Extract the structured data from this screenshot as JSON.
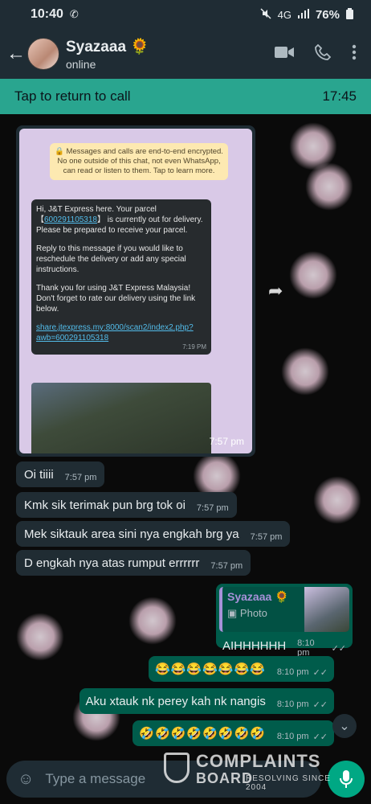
{
  "status_bar": {
    "time": "10:40",
    "network": "4G",
    "battery": "76%"
  },
  "header": {
    "contact_name": "Syazaaa 🌻",
    "contact_status": "online"
  },
  "call_banner": {
    "text": "Tap to return to call",
    "duration": "17:45"
  },
  "forwarded": {
    "encryption_note": "🔒 Messages and calls are end-to-end encrypted. No one outside of this chat, not even WhatsApp, can read or listen to them. Tap to learn more.",
    "jt_intro_prefix": "Hi, J&T Express here. Your parcel 【",
    "jt_tracking": "600291105318",
    "jt_intro_suffix": "】 is currently out for delivery. Please be prepared to receive your parcel.",
    "jt_reply": "Reply to this message if you would like to reschedule the delivery or add any special instructions.",
    "jt_thanks": "Thank you for using J&T Express Malaysia! Don't forget to rate our delivery using the link below.",
    "jt_link": "share.jtexpress.my:8000/scan2/index2.php?awb=600291105318",
    "jt_time": "7:19 PM",
    "time": "7:57 pm"
  },
  "incoming": [
    {
      "text": "Oi tiiii",
      "time": "7:57 pm"
    },
    {
      "text": "Kmk sik terimak pun brg tok oi",
      "time": "7:57 pm"
    },
    {
      "text": "Mek siktauk area sini nya engkah brg ya",
      "time": "7:57 pm"
    },
    {
      "text": "D engkah nya atas rumput errrrrr",
      "time": "7:57 pm"
    }
  ],
  "reply": {
    "quoted_name": "Syazaaa 🌻",
    "quoted_type": "Photo",
    "text": "AIHHHHHH",
    "time": "8:10 pm"
  },
  "outgoing": [
    {
      "text": "😂😂😂😂😂😂😂",
      "time": "8:10 pm"
    },
    {
      "text": "Aku xtauk nk perey kah nk nangis",
      "time": "8:10 pm"
    },
    {
      "text": "🤣🤣🤣🤣🤣🤣🤣🤣",
      "time": "8:10 pm"
    }
  ],
  "input": {
    "placeholder": "Type a message"
  },
  "watermark": {
    "line1": "COMPLAINTS",
    "line2": "BOARD",
    "line3": "RESOLVING SINCE 2004"
  }
}
